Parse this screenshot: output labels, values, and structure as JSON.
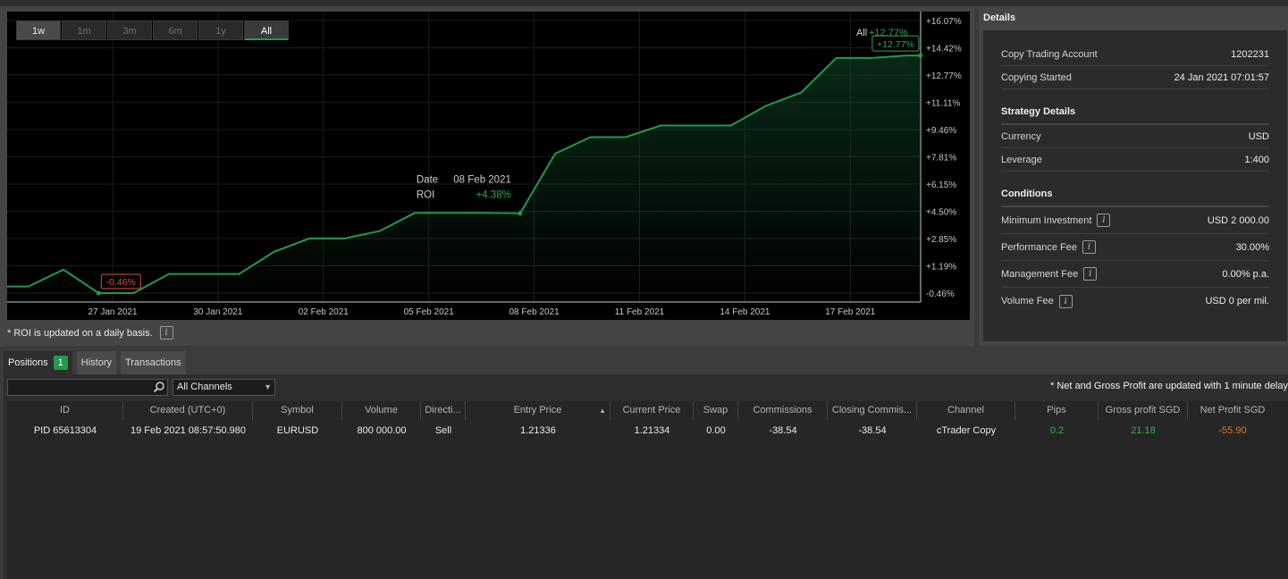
{
  "chart": {
    "range_buttons": [
      {
        "label": "1w",
        "state": "first"
      },
      {
        "label": "1m",
        "state": ""
      },
      {
        "label": "3m",
        "state": ""
      },
      {
        "label": "6m",
        "state": ""
      },
      {
        "label": "1y",
        "state": ""
      },
      {
        "label": "All",
        "state": "active"
      }
    ],
    "summary_label": "All",
    "summary_value": "+12.77%",
    "end_badge": "+12.77%",
    "min_badge": "-0.46%",
    "tooltip": {
      "date_label": "Date",
      "date_value": "08 Feb 2021",
      "roi_label": "ROI",
      "roi_value": "+4.38%"
    },
    "note": "* ROI is updated on a daily basis."
  },
  "chart_data": {
    "type": "area",
    "x_tick_labels": [
      "27 Jan 2021",
      "30 Jan 2021",
      "02 Feb 2021",
      "05 Feb 2021",
      "08 Feb 2021",
      "11 Feb 2021",
      "14 Feb 2021",
      "17 Feb 2021"
    ],
    "y_tick_labels": [
      "+16.07%",
      "+14.42%",
      "+12.77%",
      "+11.11%",
      "+9.46%",
      "+7.81%",
      "+6.15%",
      "+4.50%",
      "+2.85%",
      "+1.19%",
      "-0.46%"
    ],
    "ylim": [
      -0.46,
      16.07
    ],
    "x_day_range": [
      -3.4,
      23
    ],
    "series": [
      {
        "x_days": [
          -3.4,
          -2.4,
          -1.4,
          -0.4,
          0.6,
          1.6,
          2.6,
          3.6,
          4.6,
          5.6,
          6.6,
          7.6,
          8.6,
          9.6,
          10.6,
          11.6,
          12.6,
          13.6,
          14.6,
          15.6,
          16.6,
          17.6,
          18.6,
          19.6,
          20.6,
          21.6,
          22.6,
          23
        ],
        "values": [
          -0.06,
          -0.06,
          0.96,
          -0.46,
          -0.46,
          0.7,
          0.7,
          0.7,
          2.05,
          2.85,
          2.85,
          3.3,
          4.4,
          4.4,
          4.4,
          4.38,
          8.0,
          9.0,
          9.0,
          9.7,
          9.7,
          9.7,
          10.9,
          11.7,
          13.8,
          13.8,
          13.95,
          13.95
        ]
      }
    ],
    "colors": {
      "line": "#1f9a4f",
      "badge_positive": "#2fa84f",
      "badge_negative": "#e2533a"
    }
  },
  "details": {
    "title": "Details",
    "account_rows": [
      {
        "label": "Copy Trading Account",
        "value": "1202231"
      },
      {
        "label": "Copying Started",
        "value": "24 Jan 2021 07:01:57"
      }
    ],
    "strategy_title": "Strategy Details",
    "strategy_rows": [
      {
        "label": "Currency",
        "value": "USD"
      },
      {
        "label": "Leverage",
        "value": "1:400"
      }
    ],
    "conditions_title": "Conditions",
    "condition_rows": [
      {
        "label": "Minimum Investment",
        "value": "USD 2 000.00"
      },
      {
        "label": "Performance Fee",
        "value": "30.00%"
      },
      {
        "label": "Management Fee",
        "value": "0.00% p.a."
      },
      {
        "label": "Volume Fee",
        "value": "USD 0 per mil."
      }
    ],
    "info_glyph": "i"
  },
  "tabs": [
    {
      "label": "Positions",
      "badge": "1",
      "active": true
    },
    {
      "label": "History",
      "badge": "",
      "active": false
    },
    {
      "label": "Transactions",
      "badge": "",
      "active": false
    }
  ],
  "filters": {
    "search_value": "",
    "channel_value": "All Channels",
    "delay_note": "* Net and Gross Profit are updated with 1 minute delay"
  },
  "table": {
    "columns": [
      "ID",
      "Created (UTC+0)",
      "Symbol",
      "Volume",
      "Directi...",
      "Entry Price",
      "Current Price",
      "Swap",
      "Commissions",
      "Closing Commis...",
      "Channel",
      "Pips",
      "Gross profit SGD",
      "Net Profit SGD"
    ],
    "rows": [
      [
        "PID 65613304",
        "19 Feb 2021 08:57:50.980",
        "EURUSD",
        "800 000.00",
        "Sell",
        "1.21336",
        "1.21334",
        "0.00",
        "-38.54",
        "-38.54",
        "cTrader Copy",
        "0.2",
        "21.18",
        "-55.90"
      ]
    ]
  }
}
